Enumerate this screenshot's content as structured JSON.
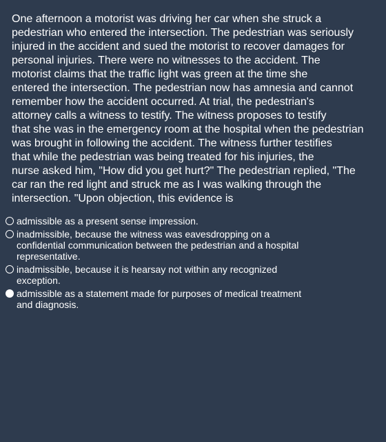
{
  "question": {
    "lines": [
      "One afternoon a motorist was driving her car when she struck a",
      "pedestrian who entered the intersection. The pedestrian was seriously",
      "injured in the accident and sued the motorist to recover damages for",
      "personal injuries. There were no witnesses to the accident. The",
      "motorist claims that the traffic light was green at the time she",
      "entered the intersection. The pedestrian now has amnesia and cannot",
      "remember how the accident occurred. At trial, the pedestrian's",
      "attorney calls a witness to testify. The witness proposes to testify",
      "that she was in the emergency room at the hospital when the pedestrian",
      "was brought in following the accident. The witness further testifies",
      "that while the pedestrian was being treated for his injuries, the",
      "nurse asked him, \"How did you get hurt?\" The pedestrian replied, \"The",
      "car ran the red light and struck me as I was walking through the",
      "intersection. \"Upon objection, this evidence is"
    ]
  },
  "options": [
    {
      "lines": [
        "admissible as a present sense impression."
      ],
      "selected": false
    },
    {
      "lines": [
        "inadmissible, because the witness was eavesdropping on a",
        "confidential communication between the pedestrian and a hospital",
        "representative."
      ],
      "selected": false
    },
    {
      "lines": [
        "inadmissible, because it is hearsay not within any recognized",
        "exception."
      ],
      "selected": false
    },
    {
      "lines": [
        "admissible as a statement made for purposes of medical treatment",
        "and diagnosis."
      ],
      "selected": true
    }
  ]
}
